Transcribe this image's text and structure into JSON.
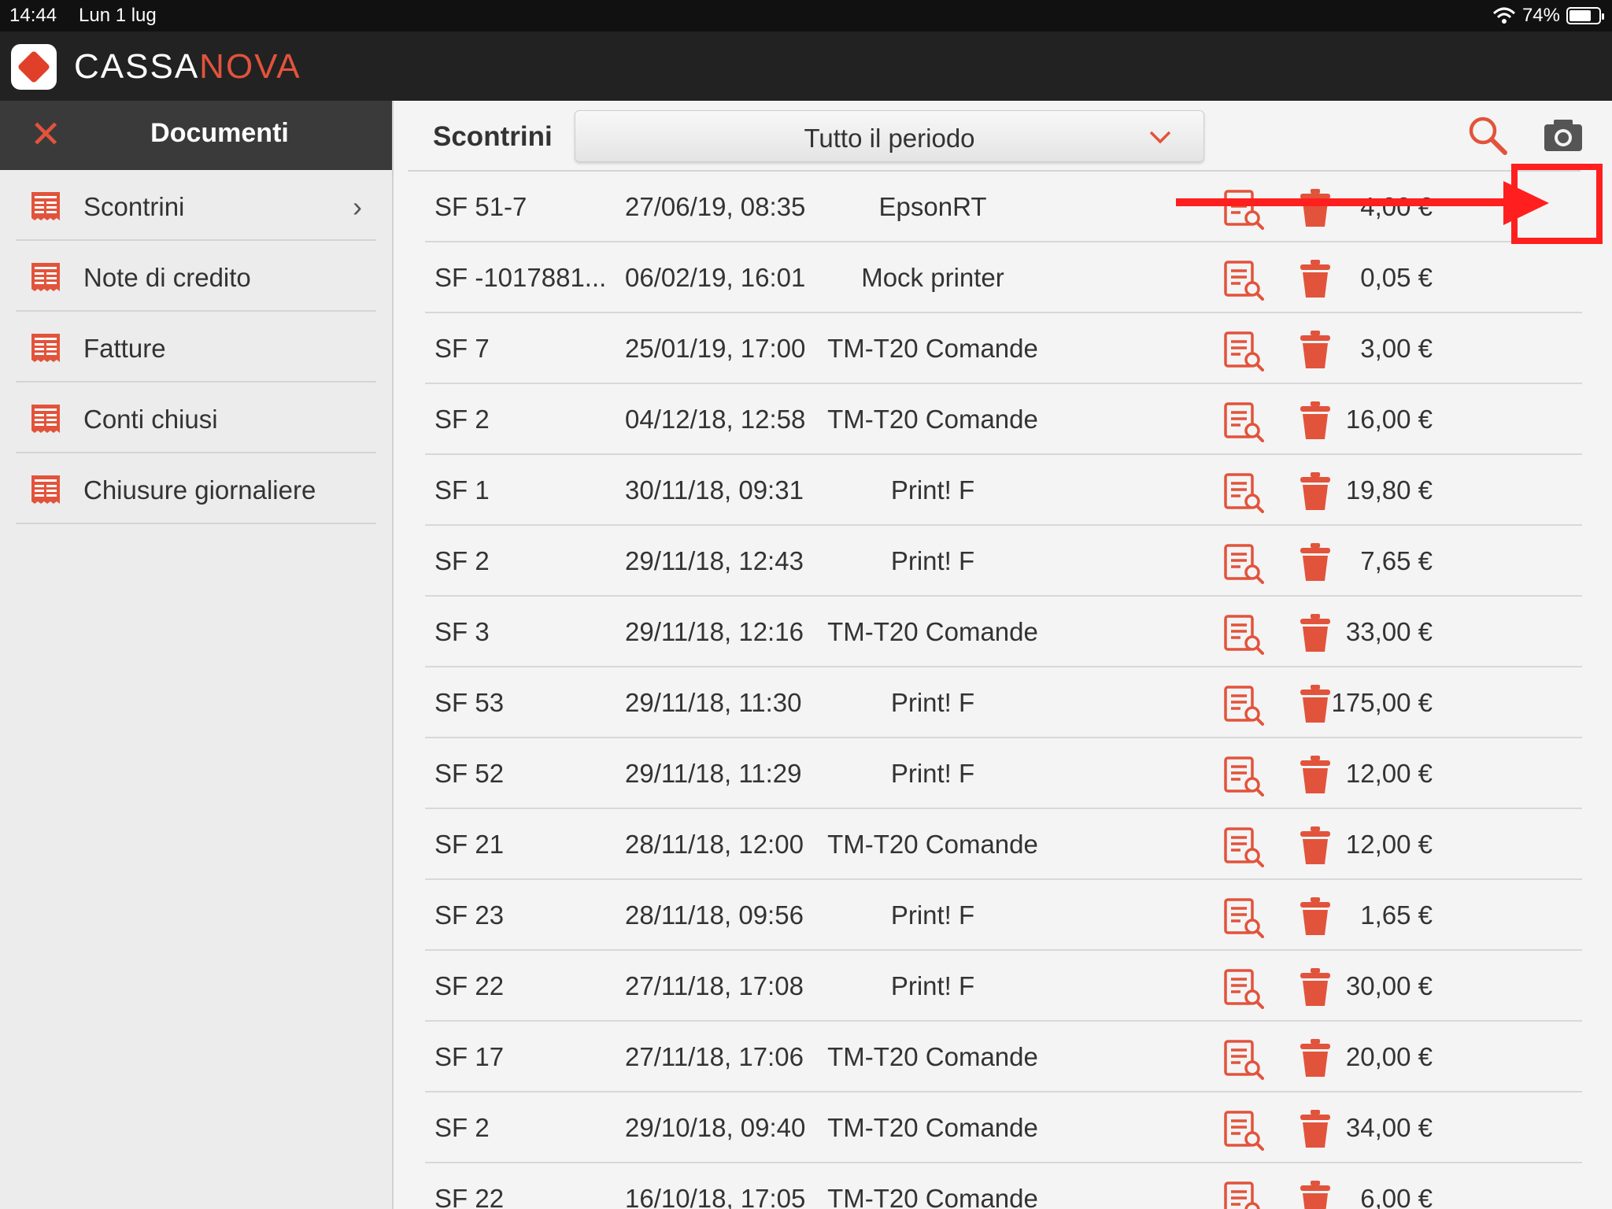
{
  "status_bar": {
    "time": "14:44",
    "date": "Lun 1 lug",
    "battery": "74%",
    "battery_level": 0.74
  },
  "app": {
    "brand_a": "CASSA",
    "brand_b": "NOVA"
  },
  "sidebar": {
    "title": "Documenti",
    "items": [
      {
        "label": "Scontrini"
      },
      {
        "label": "Note di credito"
      },
      {
        "label": "Fatture"
      },
      {
        "label": "Conti chiusi"
      },
      {
        "label": "Chiusure giornaliere"
      }
    ]
  },
  "main": {
    "title": "Scontrini",
    "period": "Tutto il periodo",
    "rows": [
      {
        "id": "SF 51-7",
        "date": "27/06/19, 08:35",
        "printer": "EpsonRT",
        "amount": "4,00 €"
      },
      {
        "id": "SF -1017881...",
        "date": "06/02/19, 16:01",
        "printer": "Mock printer",
        "amount": "0,05 €"
      },
      {
        "id": "SF 7",
        "date": "25/01/19, 17:00",
        "printer": "TM-T20 Comande",
        "amount": "3,00 €"
      },
      {
        "id": "SF 2",
        "date": "04/12/18, 12:58",
        "printer": "TM-T20 Comande",
        "amount": "16,00 €"
      },
      {
        "id": "SF 1",
        "date": "30/11/18, 09:31",
        "printer": "Print! F",
        "amount": "19,80 €"
      },
      {
        "id": "SF 2",
        "date": "29/11/18, 12:43",
        "printer": "Print! F",
        "amount": "7,65 €"
      },
      {
        "id": "SF 3",
        "date": "29/11/18, 12:16",
        "printer": "TM-T20 Comande",
        "amount": "33,00 €"
      },
      {
        "id": "SF 53",
        "date": "29/11/18, 11:30",
        "printer": "Print! F",
        "amount": "175,00 €"
      },
      {
        "id": "SF 52",
        "date": "29/11/18, 11:29",
        "printer": "Print! F",
        "amount": "12,00 €"
      },
      {
        "id": "SF 21",
        "date": "28/11/18, 12:00",
        "printer": "TM-T20 Comande",
        "amount": "12,00 €"
      },
      {
        "id": "SF 23",
        "date": "28/11/18, 09:56",
        "printer": "Print! F",
        "amount": "1,65 €"
      },
      {
        "id": "SF 22",
        "date": "27/11/18, 17:08",
        "printer": "Print! F",
        "amount": "30,00 €"
      },
      {
        "id": "SF 17",
        "date": "27/11/18, 17:06",
        "printer": "TM-T20 Comande",
        "amount": "20,00 €"
      },
      {
        "id": "SF 2",
        "date": "29/10/18, 09:40",
        "printer": "TM-T20 Comande",
        "amount": "34,00 €"
      },
      {
        "id": "SF 22",
        "date": "16/10/18, 17:05",
        "printer": "TM-T20 Comande",
        "amount": "6,00 €"
      }
    ]
  },
  "colors": {
    "accent": "#e2533b",
    "annotation": "#ff1f1f",
    "header": "#222222"
  },
  "icons": {
    "document": "receipt-doc-icon",
    "view": "document-search-icon",
    "delete": "trash-icon",
    "search": "search-icon",
    "camera": "camera-icon",
    "close": "close-icon",
    "chevron": "chevron-right-icon"
  }
}
